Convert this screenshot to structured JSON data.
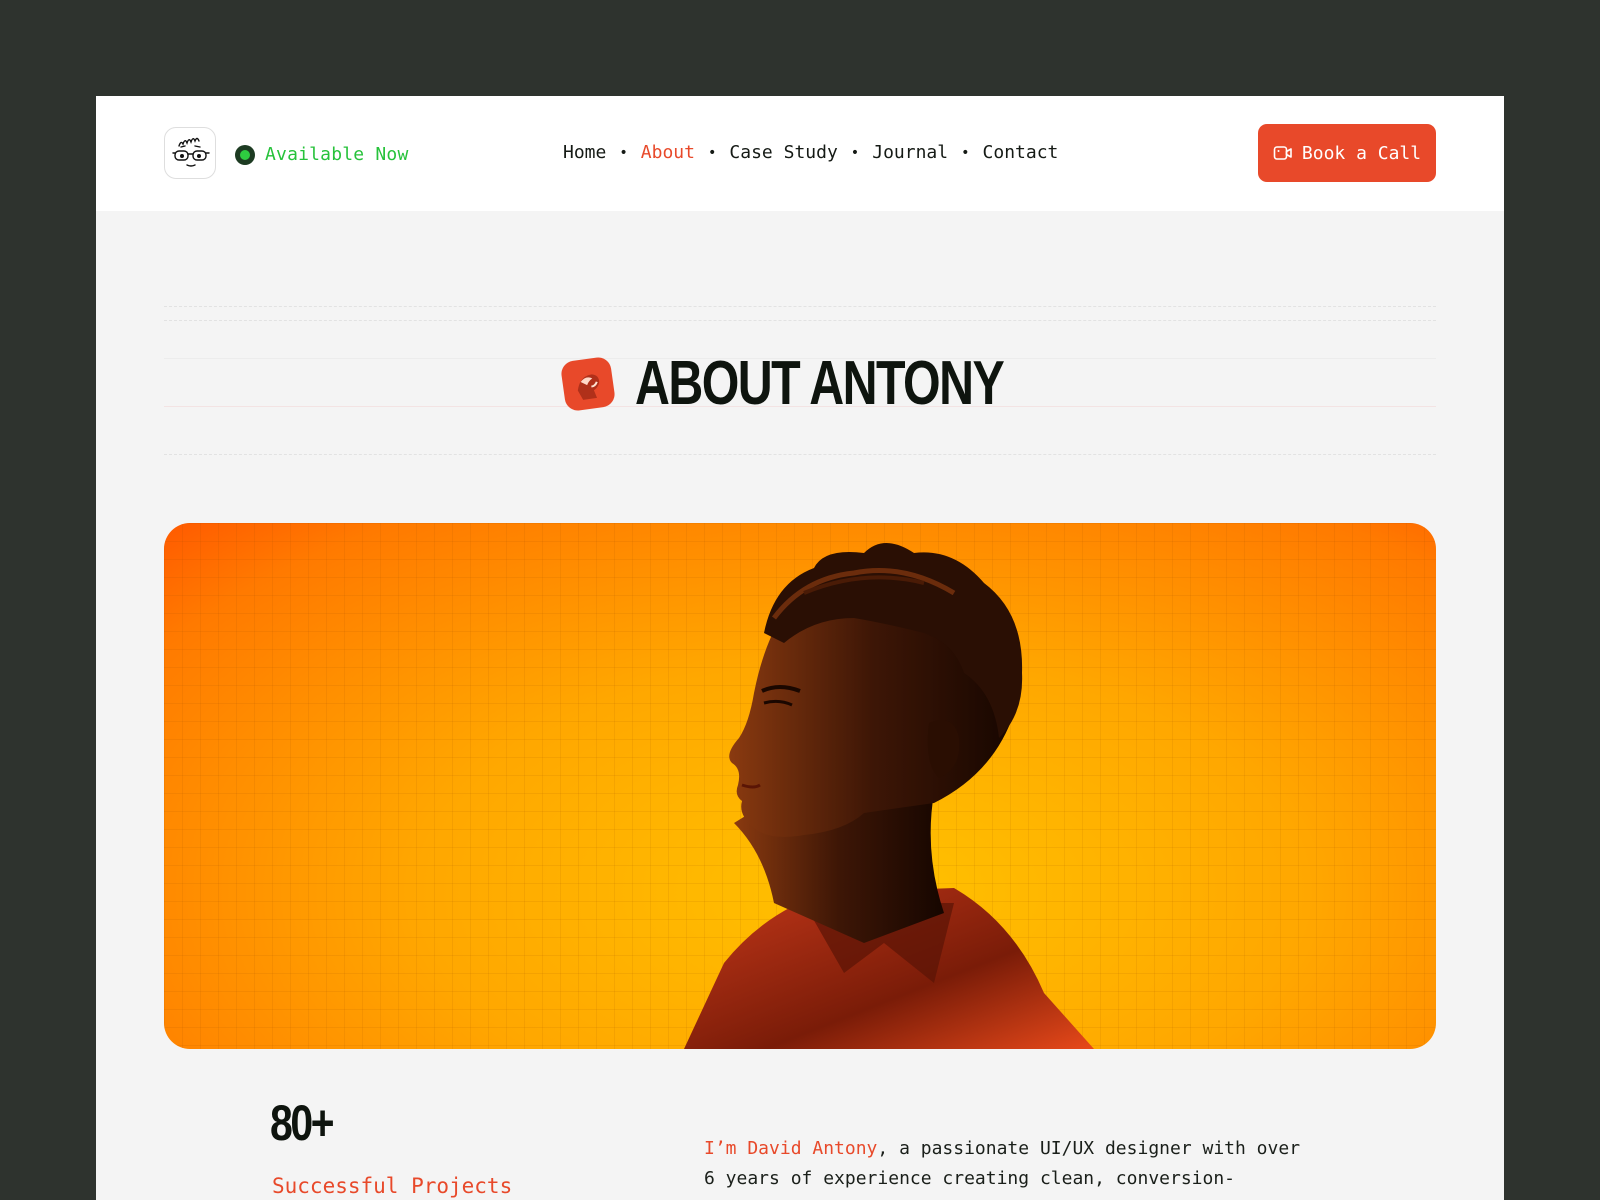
{
  "header": {
    "status_label": "Available Now",
    "nav": [
      {
        "label": "Home",
        "active": false
      },
      {
        "label": "About",
        "active": true
      },
      {
        "label": "Case Study",
        "active": false
      },
      {
        "label": "Journal",
        "active": false
      },
      {
        "label": "Contact",
        "active": false
      }
    ],
    "nav_separator": "•",
    "cta_label": "Book a Call"
  },
  "page": {
    "title": "ABOUT ANTONY"
  },
  "stats": {
    "value": "80+",
    "label": "Successful Projects"
  },
  "bio": {
    "highlight": "I’m David Antony",
    "text": ", a passionate UI/UX designer with over 6 years of experience creating clean, conversion-focused digital experiences. I specialize in designing modern"
  },
  "colors": {
    "accent": "#e8492a",
    "status_green": "#27c23b",
    "background_dark": "#2e332e",
    "surface": "#f4f4f4"
  },
  "icons": {
    "logo": "glasses-face-icon",
    "status": "status-dot-icon",
    "cta": "video-camera-icon",
    "title_badge": "portrait-badge-icon"
  }
}
